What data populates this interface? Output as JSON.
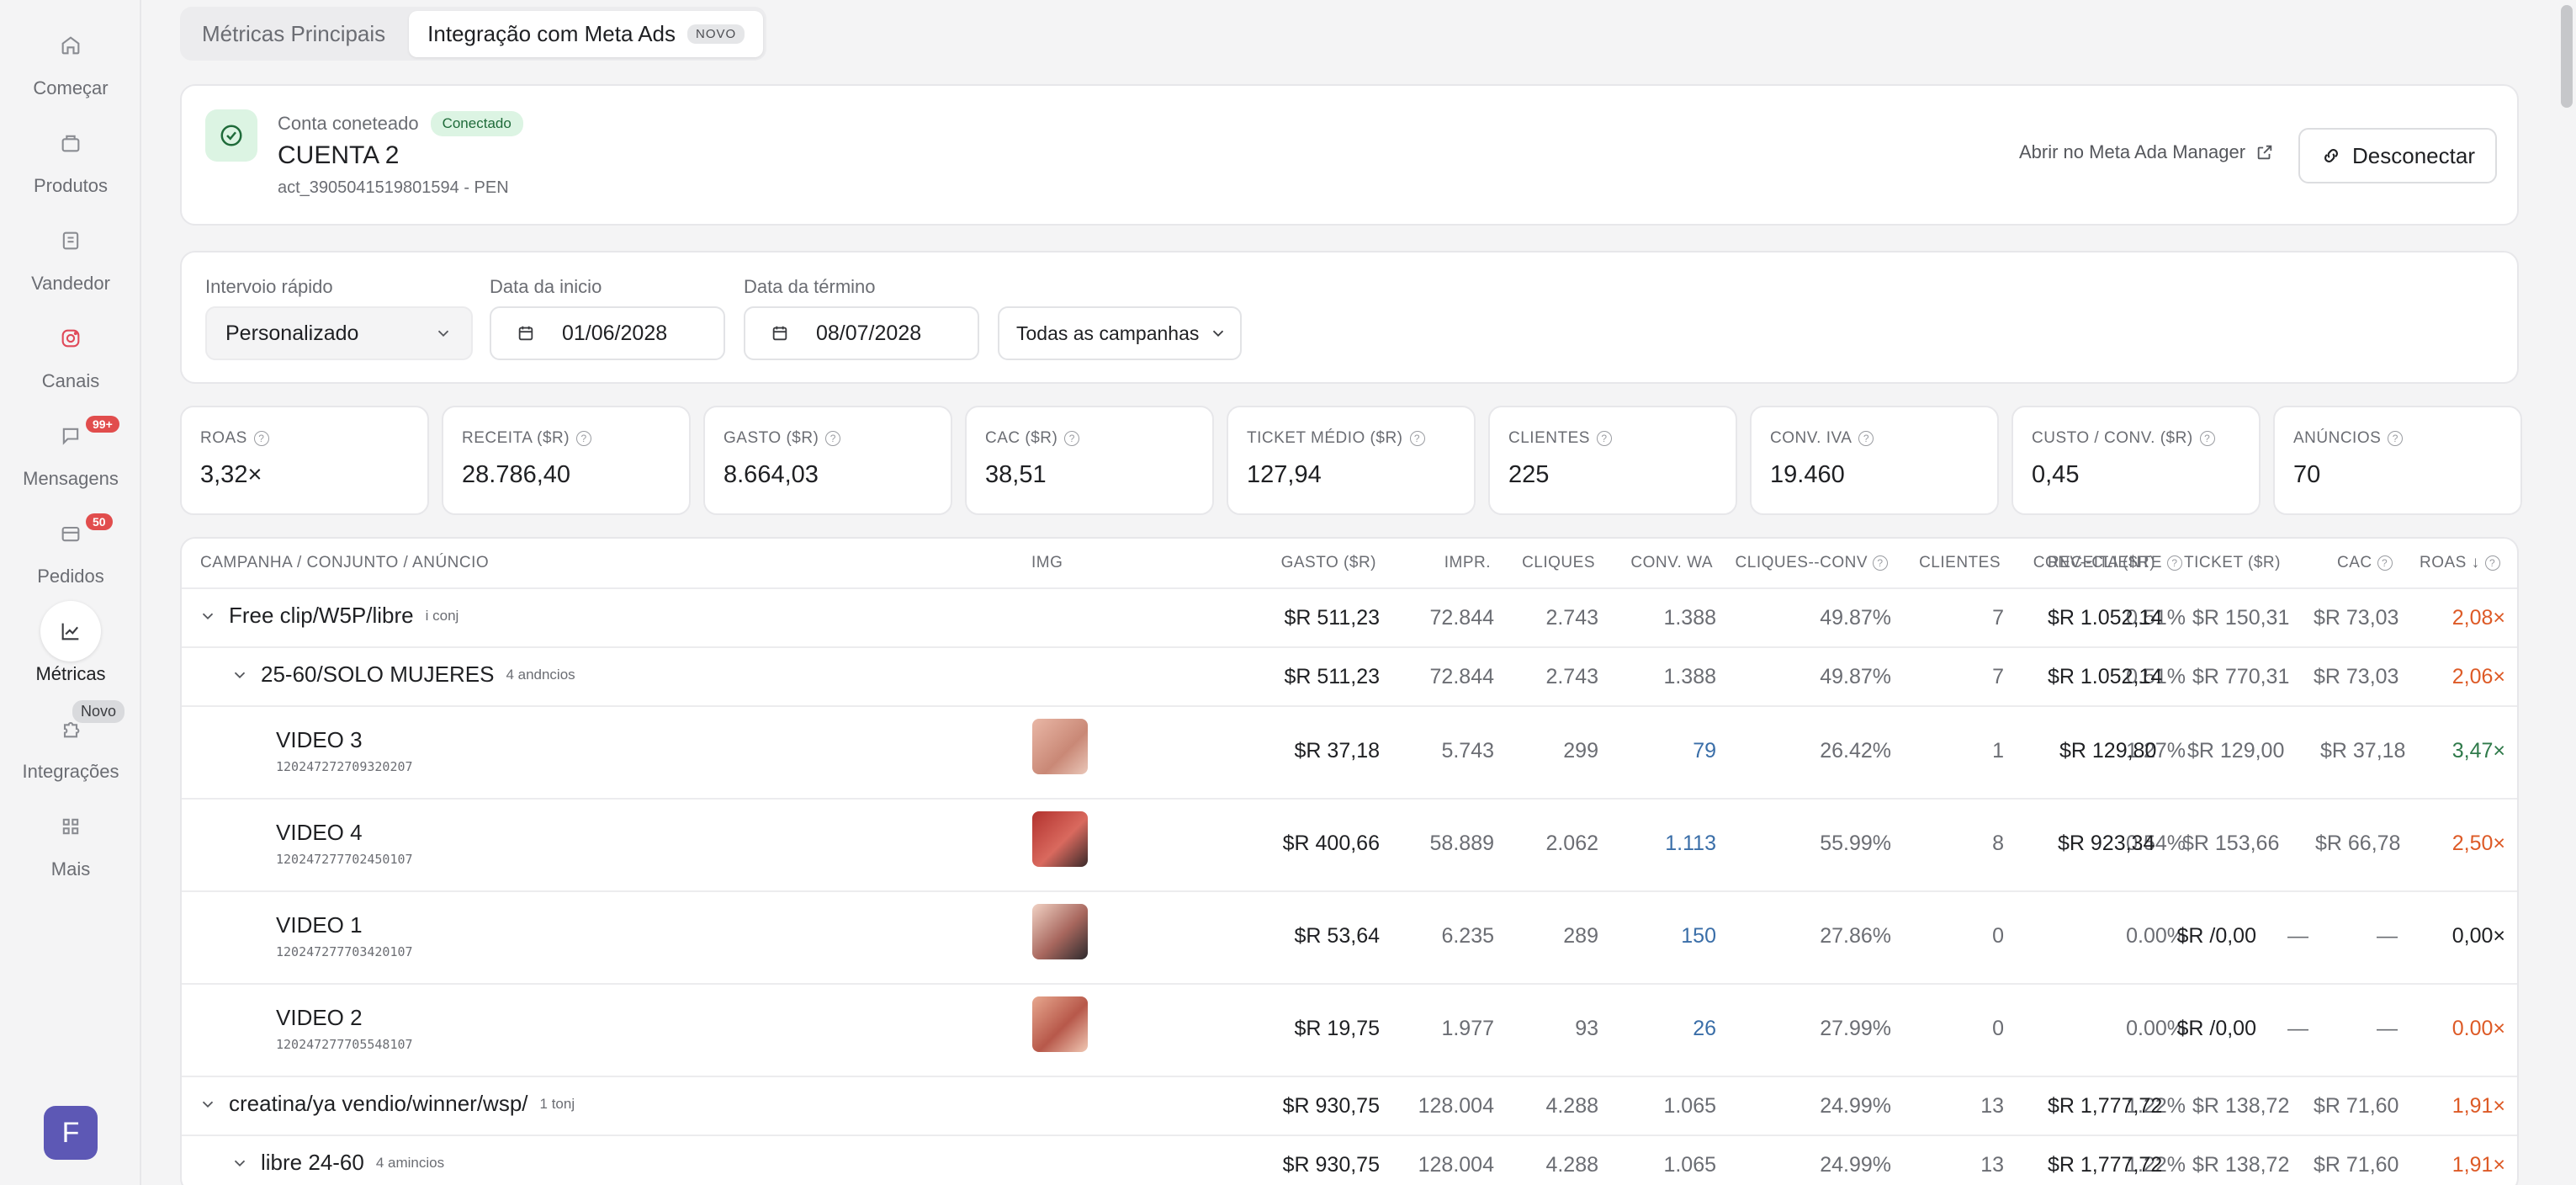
{
  "sidebar": {
    "items": [
      {
        "label": "Começar",
        "icon": "home-icon"
      },
      {
        "label": "Produtos",
        "icon": "box-icon"
      },
      {
        "label": "Vandedor",
        "icon": "store-icon"
      },
      {
        "label": "Canais",
        "icon": "instagram-icon"
      },
      {
        "label": "Mensagens",
        "icon": "chat-icon",
        "badge": "99+"
      },
      {
        "label": "Pedidos",
        "icon": "orders-icon",
        "badge": "50"
      },
      {
        "label": "Métricas",
        "icon": "chart-icon"
      },
      {
        "label": "Integrações",
        "icon": "puzzle-icon",
        "tag": "Novo"
      },
      {
        "label": "Mais",
        "icon": "grid-icon"
      }
    ],
    "avatar": "F"
  },
  "tabs": {
    "main": "Métricas Principais",
    "meta": "Integração com Meta Ads",
    "meta_badge": "NOVO"
  },
  "account": {
    "label": "Conta coneteado",
    "status": "Conectado",
    "name": "CUENTA 2",
    "id": "act_3905041519801594 - PEN",
    "meta_link": "Abrir no Meta Ada Manager",
    "disconnect": "Desconectar"
  },
  "filters": {
    "range_label": "Intervoio rápido",
    "range_value": "Personalizado",
    "start_label": "Data da inicio",
    "start_value": "01/06/2028",
    "end_label": "Data da término",
    "end_value": "08/07/2028",
    "campaigns": "Todas as campanhas"
  },
  "stats": [
    {
      "label": "ROAS",
      "value": "3,32×"
    },
    {
      "label": "RECEITA ($R)",
      "value": "28.786,40"
    },
    {
      "label": "GASTO ($R)",
      "value": "8.664,03"
    },
    {
      "label": "CAC ($R)",
      "value": "38,51"
    },
    {
      "label": "TICKET MÉDIO ($R)",
      "value": "127,94"
    },
    {
      "label": "CLIENTES",
      "value": "225"
    },
    {
      "label": "CONV. IVA",
      "value": "19.460"
    },
    {
      "label": "CUSTO / CONV. ($R)",
      "value": "0,45"
    },
    {
      "label": "ANÚNCIOS",
      "value": "70"
    }
  ],
  "table": {
    "headers": {
      "campaign": "CAMPANHA / CONJUNTO / ANÚNCIO",
      "img": "IMG",
      "gasto": "GASTO ($R)",
      "impr": "IMPR.",
      "cliques": "CLIQUES",
      "conv": "CONV. WA",
      "cc": "CLIQUES--CONV",
      "clientes": "CLIENTES",
      "convc": "CONV--CLIENTE",
      "receita": "RECEITA ($R)",
      "ticket": "TICKET ($R)",
      "cac": "CAC",
      "roas": "ROAS ↓"
    },
    "rows": [
      {
        "name": "Free clip/W5P/libre",
        "sub": "i conj",
        "gasto": "$R 511,23",
        "impr": "72.844",
        "cliques": "2.743",
        "conv": "1.388",
        "cc": "49.87%",
        "clientes": "7",
        "convc": "0.51%",
        "receita": "$R 1.052,14",
        "ticket": "$R 150,31",
        "cac": "$R 73,03",
        "roas": "2,08×"
      },
      {
        "name": "25-60/SOLO MUJERES",
        "sub": "4 andncios",
        "gasto": "$R 511,23",
        "impr": "72.844",
        "cliques": "2.743",
        "conv": "1.388",
        "cc": "49.87%",
        "clientes": "7",
        "convc": "0.51%",
        "receita": "$R 1.052,14",
        "ticket": "$R 770,31",
        "cac": "$R 73,03",
        "roas": "2,06×"
      },
      {
        "name": "VIDEO 3",
        "id": "120247272709320207",
        "gasto": "$R 37,18",
        "impr": "5.743",
        "cliques": "299",
        "conv": "79",
        "cc": "26.42%",
        "clientes": "1",
        "convc": "1.27%",
        "receita": "$R 129,80",
        "ticket": "$R 129,00",
        "cac": "$R 37,18",
        "roas": "3,47×"
      },
      {
        "name": "VIDEO 4",
        "id": "120247277702450107",
        "gasto": "$R 400,66",
        "impr": "58.889",
        "cliques": "2.062",
        "conv": "1.113",
        "cc": "55.99%",
        "clientes": "8",
        "convc": "0.54%",
        "receita": "$R 923,34",
        "ticket": "$R 153,66",
        "cac": "$R 66,78",
        "roas": "2,50×"
      },
      {
        "name": "VIDEO 1",
        "id": "120247277703420107",
        "gasto": "$R 53,64",
        "impr": "6.235",
        "cliques": "289",
        "conv": "150",
        "cc": "27.86%",
        "clientes": "0",
        "convc": "0.00%",
        "receita": "$R /0,00",
        "ticket": "—",
        "cac": "—",
        "roas": "0,00×"
      },
      {
        "name": "VIDEO 2",
        "id": "120247277705548107",
        "gasto": "$R 19,75",
        "impr": "1.977",
        "cliques": "93",
        "conv": "26",
        "cc": "27.99%",
        "clientes": "0",
        "convc": "0.00%",
        "receita": "$R /0,00",
        "ticket": "—",
        "cac": "—",
        "roas": "0.00×"
      },
      {
        "name": "creatina/ya vendio/winner/wsp/",
        "sub": "1 tonj",
        "gasto": "$R 930,75",
        "impr": "128.004",
        "cliques": "4.288",
        "conv": "1.065",
        "cc": "24.99%",
        "clientes": "13",
        "convc": "1.22%",
        "receita": "$R 1,777,72",
        "ticket": "$R 138,72",
        "cac": "$R 71,60",
        "roas": "1,91×"
      },
      {
        "name": "libre 24-60",
        "sub": "4 amincios",
        "gasto": "$R 930,75",
        "impr": "128.004",
        "cliques": "4.288",
        "conv": "1.065",
        "cc": "24.99%",
        "clientes": "13",
        "convc": "1.22%",
        "receita": "$R 1,777,72",
        "ticket": "$R 138,72",
        "cac": "$R 71,60",
        "roas": "1,91×"
      }
    ]
  },
  "colors": {
    "accent": "#5d58b5",
    "success": "#dcf4e3",
    "roas_orange": "#dd5a26",
    "roas_green": "#2f7a4a",
    "conv_blue": "#3a6ea8"
  }
}
